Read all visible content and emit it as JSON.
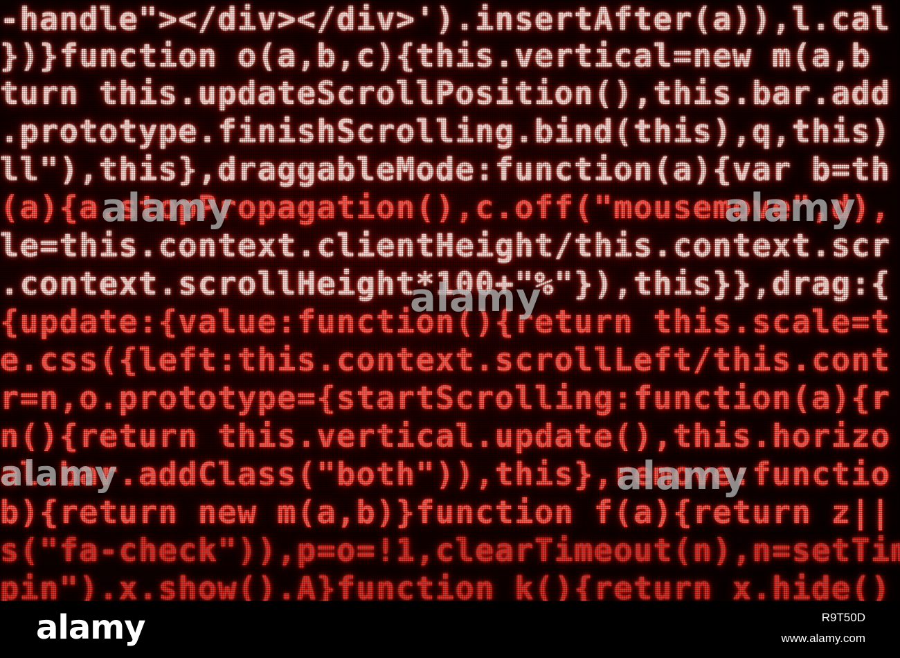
{
  "code_lines": [
    "-handle\"></div></div>').insertAfter(a)),l.cal",
    "})}function o(a,b,c){this.vertical=new m(a,b",
    "turn this.updateScrollPosition(),this.bar.add",
    ".prototype.finishScrolling.bind(this),q,this)",
    "ll\"),this},draggableMode:function(a){var b=th",
    "(a){a.stopPropagation(),c.off(\"mousemove\",d),",
    "le=this.context.clientHeight/this.context.scr",
    ".context.scrollHeight*100+\"%\"}),this}},drag:{",
    "{update:{value:function(){return this.scale=t",
    "e.css({left:this.context.scrollLeft/this.cont",
    "r=n,o.prototype={startScrolling:function(a){r",
    "n(){return this.vertical.update(),this.horizo",
    "al.bar.addClass(\"both\")),this},remove:functio",
    "b){return new m(a,b)}function f(a){return z||",
    "s(\"fa-check\")),p=o=!1,clearTimeout(n),n=setTim",
    "pin\").x.show().A}function k(){return x.hide()"
  ],
  "watermark": {
    "text": "alamy"
  },
  "footer": {
    "logo": "alamy",
    "image_id": "R9T50D",
    "url": "www.alamy.com"
  },
  "colors": {
    "background": "#000000",
    "code_glow": "#ff3b30",
    "code_bright": "#ffd8d2"
  }
}
